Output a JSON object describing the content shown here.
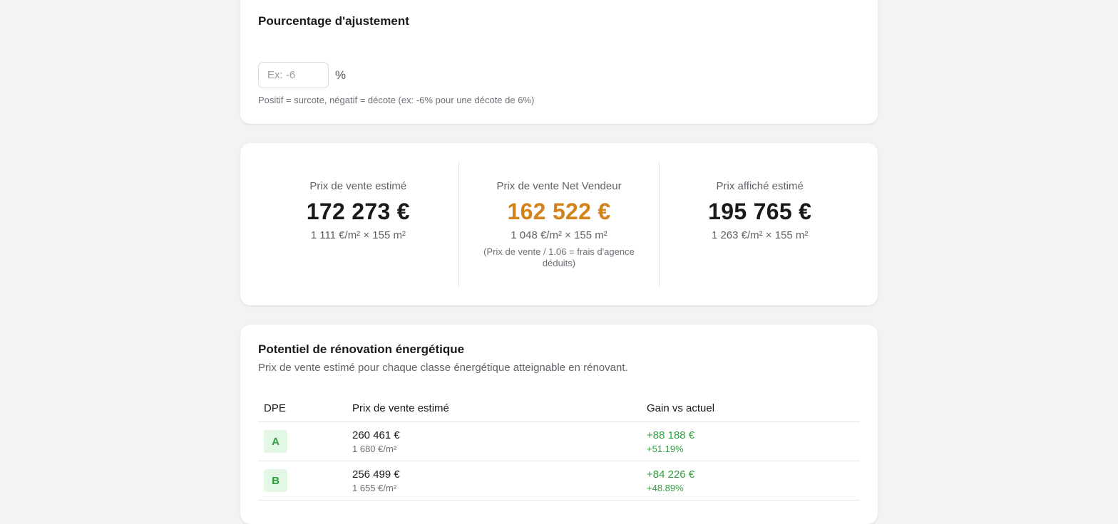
{
  "adjustment": {
    "title": "Pourcentage d'ajustement",
    "placeholder": "Ex: -6",
    "value": "",
    "unit": "%",
    "hint": "Positif = surcote, négatif = décote (ex: -6% pour une décote de 6%)"
  },
  "prices": [
    {
      "label": "Prix de vente estimé",
      "value": "172 273 €",
      "calc": "1 111 €/m² × 155 m²",
      "note": ""
    },
    {
      "label": "Prix de vente Net Vendeur",
      "value": "162 522 €",
      "calc": "1 048 €/m² × 155 m²",
      "note": "(Prix de vente / 1.06 = frais d'agence déduits)"
    },
    {
      "label": "Prix affiché estimé",
      "value": "195 765 €",
      "calc": "1 263 €/m² × 155 m²",
      "note": ""
    }
  ],
  "renovation": {
    "title": "Potentiel de rénovation énergétique",
    "subtitle": "Prix de vente estimé pour chaque classe énergétique atteignable en rénovant.",
    "headers": [
      "DPE",
      "Prix de vente estimé",
      "Gain vs actuel"
    ],
    "rows": [
      {
        "dpe": "A",
        "price": "260 461 €",
        "per_m2": "1 680 €/m²",
        "gain": "+88 188 €",
        "gain_pct": "+51.19%"
      },
      {
        "dpe": "B",
        "price": "256 499 €",
        "per_m2": "1 655 €/m²",
        "gain": "+84 226 €",
        "gain_pct": "+48.89%"
      }
    ]
  },
  "colors": {
    "accent": "#d4821a",
    "gain": "#2e9e3e",
    "dpe_badge_bg": "#e3f7e6",
    "dpe_badge_text": "#2e9e3e"
  }
}
